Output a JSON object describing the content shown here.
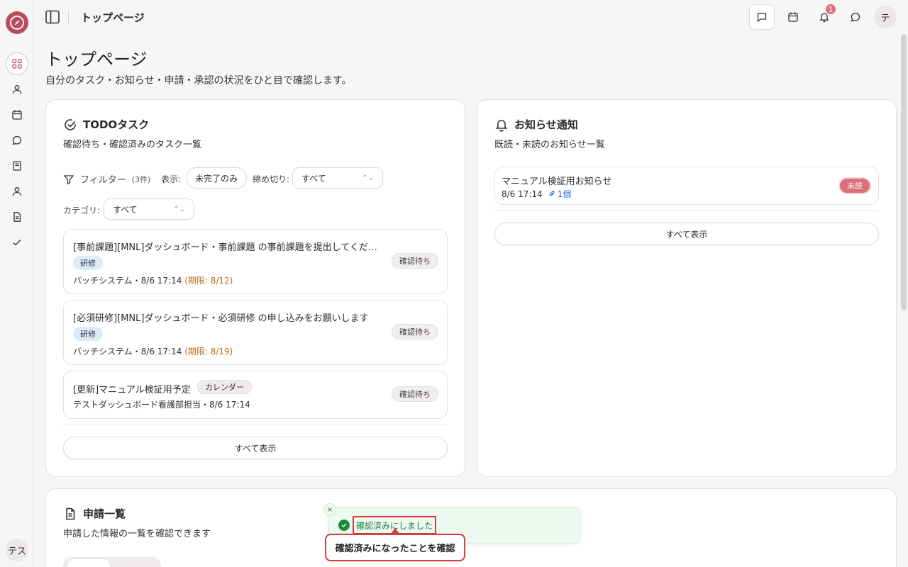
{
  "header": {
    "title": "トップページ",
    "notification_count": "1",
    "user_initial": "テ"
  },
  "sidebar": {
    "items": [
      "dashboard",
      "user",
      "calendar",
      "chat",
      "book",
      "user",
      "document",
      "check"
    ],
    "user_label": "テス"
  },
  "page": {
    "title": "トップページ",
    "subtitle": "自分のタスク・お知らせ・申請・承認の状況をひと目で確認します。"
  },
  "todo": {
    "title": "TODOタスク",
    "description": "確認待ち・確認済みのタスク一覧",
    "filter_label": "フィルター",
    "filter_count": "(3件)",
    "display_label": "表示:",
    "display_value": "未完了のみ",
    "deadline_label": "締め切り:",
    "deadline_value": "すべて",
    "category_label": "カテゴリ:",
    "category_value": "すべて",
    "tasks": [
      {
        "title": "[事前課題][MNL]ダッシュボード・事前課題 の事前課題を提出してくだ…",
        "tag": "研修",
        "status": "確認待ち",
        "meta": "バッチシステム・8/6 17:14",
        "due": "(期限: 8/12)"
      },
      {
        "title": "[必須研修][MNL]ダッシュボード・必須研修 の申し込みをお願いします",
        "tag": "研修",
        "status": "確認待ち",
        "meta": "バッチシステム・8/6 17:14",
        "due": "(期限: 8/19)"
      },
      {
        "title": "[更新]マニュアル検証用予定",
        "tag": "カレンダー",
        "status": "確認待ち",
        "meta": "テストダッシュボード看護部担当・8/6 17:14",
        "due": ""
      }
    ],
    "show_all": "すべて表示"
  },
  "notices": {
    "title": "お知らせ通知",
    "description": "既読・未読のお知らせ一覧",
    "items": [
      {
        "title": "マニュアル検証用お知らせ",
        "date": "8/6 17:14",
        "attachments": "1個",
        "status": "未読"
      }
    ],
    "show_all": "すべて表示"
  },
  "applications": {
    "title": "申請一覧",
    "description": "申請した情報の一覧を確認できます"
  },
  "toast": {
    "message": "確認済みにしました",
    "close": "×"
  },
  "callout": {
    "text": "確認済みになったことを確認"
  },
  "colors": {
    "brand": "#b84d5f",
    "unread_badge": "#d9707a",
    "due_text": "#c06a1a",
    "toast_bg": "#ecfaf1",
    "highlight": "#d83b3b"
  }
}
